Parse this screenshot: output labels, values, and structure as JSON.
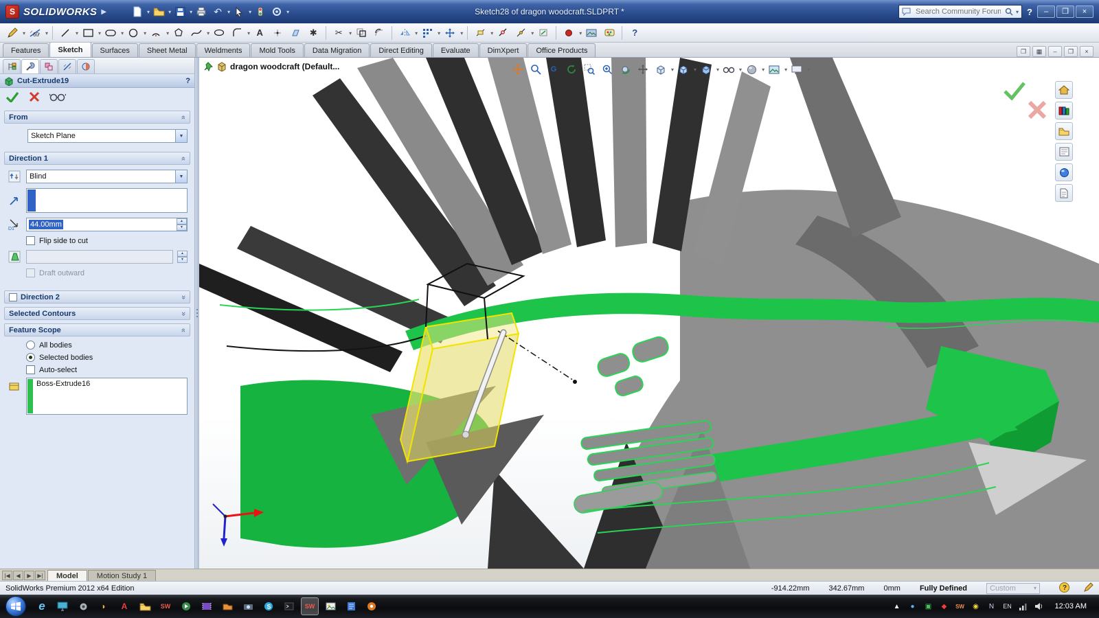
{
  "window": {
    "app_name": "SOLIDWORKS",
    "title": "Sketch28 of dragon woodcraft.SLDPRT *",
    "search_placeholder": "Search Community Forum"
  },
  "command_tabs": [
    {
      "label": "Features"
    },
    {
      "label": "Sketch"
    },
    {
      "label": "Surfaces"
    },
    {
      "label": "Sheet Metal"
    },
    {
      "label": "Weldments"
    },
    {
      "label": "Mold Tools"
    },
    {
      "label": "Data Migration"
    },
    {
      "label": "Direct Editing"
    },
    {
      "label": "Evaluate"
    },
    {
      "label": "DimXpert"
    },
    {
      "label": "Office Products"
    }
  ],
  "property_manager": {
    "title": "Cut-Extrude19",
    "help": "?",
    "from": {
      "header": "From",
      "plane": "Sketch Plane"
    },
    "direction1": {
      "header": "Direction 1",
      "end_condition": "Blind",
      "depth": "44.00mm",
      "depth_label": "D1",
      "flip_side": "Flip side to cut",
      "draft_outward": "Draft outward"
    },
    "direction2": {
      "header": "Direction 2"
    },
    "selected_contours": {
      "header": "Selected Contours"
    },
    "feature_scope": {
      "header": "Feature Scope",
      "all_bodies": "All bodies",
      "selected_bodies": "Selected bodies",
      "auto_select": "Auto-select",
      "body": "Boss-Extrude16"
    }
  },
  "viewport": {
    "document_label": "dragon woodcraft  (Default..."
  },
  "doc_tabs": {
    "model": "Model",
    "motion_study": "Motion Study 1"
  },
  "status_bar": {
    "edition": "SolidWorks Premium 2012 x64 Edition",
    "coord_x": "-914.22mm",
    "coord_y": "342.67mm",
    "coord_z": "0mm",
    "state": "Fully Defined",
    "unit_system": "Custom"
  },
  "taskbar": {
    "clock": "12:03 AM"
  }
}
